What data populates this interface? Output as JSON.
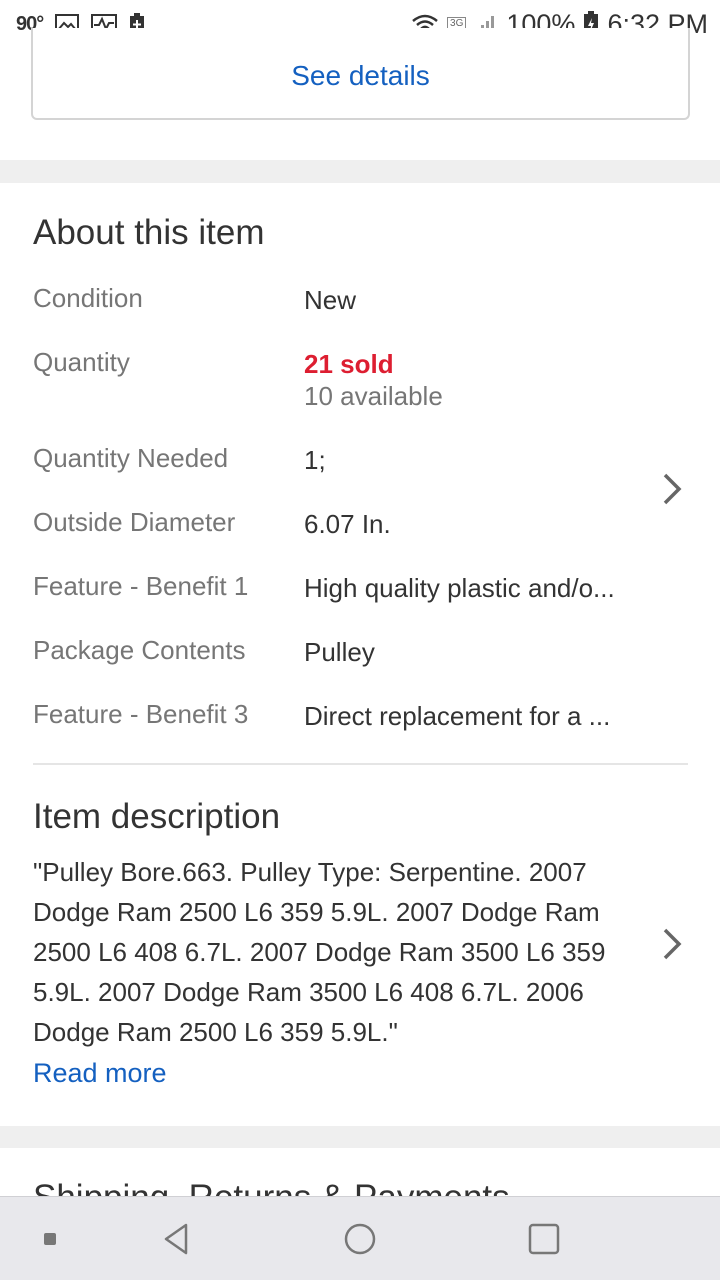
{
  "status_bar": {
    "temperature": "90°",
    "network_type": "3G",
    "battery": "100%",
    "time": "6:32 PM"
  },
  "see_details": {
    "label": "See details"
  },
  "about": {
    "title": "About this item",
    "specs": [
      {
        "label": "Condition",
        "value": "New"
      },
      {
        "label": "Quantity",
        "value": "21 sold",
        "sub_value": "10 available"
      },
      {
        "label": "Quantity Needed",
        "value": "1;"
      },
      {
        "label": "Outside Diameter",
        "value": "6.07 In."
      },
      {
        "label": "Feature - Benefit 1",
        "value": "High quality plastic and/o..."
      },
      {
        "label": "Package Contents",
        "value": "Pulley"
      },
      {
        "label": "Feature - Benefit 3",
        "value": "Direct replacement for a ..."
      }
    ]
  },
  "description": {
    "title": "Item description",
    "text": "\"Pulley Bore.663. Pulley Type: Serpentine. 2007 Dodge Ram 2500 L6 359 5.9L. 2007 Dodge Ram 2500 L6 408 6.7L. 2007 Dodge Ram 3500 L6 359 5.9L. 2007 Dodge Ram 3500 L6 408 6.7L. 2006 Dodge Ram 2500 L6 359 5.9L.\"",
    "read_more": "Read more"
  },
  "shipping": {
    "title": "Shipping, Returns & Payments"
  },
  "colors": {
    "link": "#1460c0",
    "sold": "#dd1e31",
    "label": "#767676"
  },
  "icons": {
    "status_left": [
      "image-icon",
      "activity-icon",
      "battery-saver-icon"
    ],
    "status_right": [
      "wifi-icon",
      "signal-icon",
      "battery-icon"
    ],
    "nav": [
      "square-dot-icon",
      "back-icon",
      "home-icon",
      "recents-icon"
    ]
  }
}
